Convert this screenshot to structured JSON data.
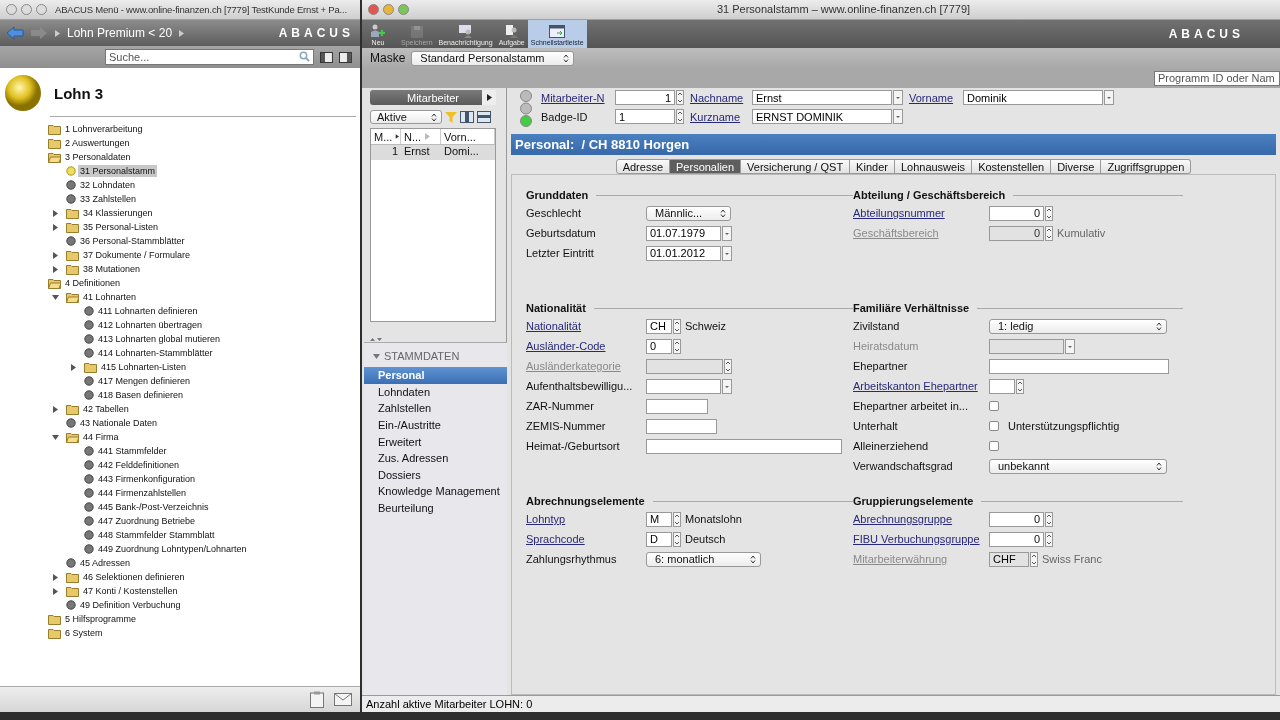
{
  "menu_window": {
    "title": "ABACUS Menü - www.online-finanzen.ch [7779] TestKunde Ernst + Pa...",
    "breadcrumb": "Lohn Premium < 20",
    "logo": "ABACUS",
    "search": {
      "placeholder": "Suche..."
    },
    "heading": "Lohn 3",
    "tree": [
      {
        "label": "1 Lohnverarbeitung",
        "kind": "folder",
        "expanded": false,
        "selected": false
      },
      {
        "label": "2 Auswertungen",
        "kind": "folder",
        "expanded": false,
        "selected": false
      },
      {
        "label": "3 Personaldaten",
        "kind": "folder",
        "expanded": true,
        "selected": false,
        "children": [
          {
            "label": "31 Personalstamm",
            "kind": "program",
            "selected": true
          },
          {
            "label": "32 Lohndaten",
            "kind": "program",
            "selected": false
          },
          {
            "label": "33 Zahlstellen",
            "kind": "program",
            "selected": false
          },
          {
            "label": "34 Klassierungen",
            "kind": "folder",
            "expanded": false,
            "selected": false
          },
          {
            "label": "35 Personal-Listen",
            "kind": "folder",
            "expanded": false,
            "selected": false
          },
          {
            "label": "36 Personal-Stammblätter",
            "kind": "program",
            "selected": false
          },
          {
            "label": "37 Dokumente / Formulare",
            "kind": "folder",
            "expanded": false,
            "selected": false
          },
          {
            "label": "38 Mutationen",
            "kind": "folder",
            "expanded": false,
            "selected": false
          }
        ]
      },
      {
        "label": "4 Definitionen",
        "kind": "folder",
        "expanded": true,
        "selected": false,
        "children": [
          {
            "label": "41 Lohnarten",
            "kind": "folder",
            "expanded": true,
            "selected": false,
            "children": [
              {
                "label": "411 Lohnarten definieren",
                "kind": "program",
                "selected": false
              },
              {
                "label": "412 Lohnarten übertragen",
                "kind": "program",
                "selected": false
              },
              {
                "label": "413 Lohnarten global mutieren",
                "kind": "program",
                "selected": false
              },
              {
                "label": "414 Lohnarten-Stammblätter",
                "kind": "program",
                "selected": false
              },
              {
                "label": "415 Lohnarten-Listen",
                "kind": "folder",
                "expanded": false,
                "selected": false
              },
              {
                "label": "417 Mengen definieren",
                "kind": "program",
                "selected": false
              },
              {
                "label": "418 Basen definieren",
                "kind": "program",
                "selected": false
              }
            ]
          },
          {
            "label": "42 Tabellen",
            "kind": "folder",
            "expanded": false,
            "selected": false
          },
          {
            "label": "43 Nationale Daten",
            "kind": "program",
            "selected": false
          },
          {
            "label": "44 Firma",
            "kind": "folder",
            "expanded": true,
            "selected": false,
            "children": [
              {
                "label": "441 Stammfelder",
                "kind": "program",
                "selected": false
              },
              {
                "label": "442 Felddefinitionen",
                "kind": "program",
                "selected": false
              },
              {
                "label": "443 Firmenkonfiguration",
                "kind": "program",
                "selected": false
              },
              {
                "label": "444 Firmenzahlstellen",
                "kind": "program",
                "selected": false
              },
              {
                "label": "445 Bank-/Post-Verzeichnis",
                "kind": "program",
                "selected": false
              },
              {
                "label": "447 Zuordnung Betriebe",
                "kind": "program",
                "selected": false
              },
              {
                "label": "448 Stammfelder Stammblatt",
                "kind": "program",
                "selected": false
              },
              {
                "label": "449 Zuordnung Lohntypen/Lohnarten",
                "kind": "program",
                "selected": false
              }
            ]
          },
          {
            "label": "45 Adressen",
            "kind": "program",
            "selected": false
          },
          {
            "label": "46 Selektionen definieren",
            "kind": "folder",
            "expanded": false,
            "selected": false
          },
          {
            "label": "47 Konti / Kostenstellen",
            "kind": "folder",
            "expanded": false,
            "selected": false
          },
          {
            "label": "49 Definition Verbuchung",
            "kind": "program",
            "selected": false
          }
        ]
      },
      {
        "label": "5 Hilfsprogramme",
        "kind": "folder",
        "expanded": false,
        "selected": false
      },
      {
        "label": "6 System",
        "kind": "folder",
        "expanded": false,
        "selected": false
      }
    ]
  },
  "program_window": {
    "title": "31 Personalstamm – www.online-finanzen.ch [7779]",
    "logo": "ABACUS",
    "toolbar": [
      {
        "label": "Neu",
        "kind": "new",
        "selected": false,
        "disabled": false
      },
      {
        "label": "Speichern",
        "kind": "save",
        "selected": false,
        "disabled": true
      },
      {
        "label": "Benachrichtigung",
        "kind": "notify",
        "selected": false,
        "disabled": false
      },
      {
        "label": "Aufgabe",
        "kind": "task",
        "selected": false,
        "disabled": false
      },
      {
        "label": "Schnellstartleiste",
        "kind": "quick",
        "selected": true,
        "disabled": false
      }
    ],
    "mask": {
      "label": "Maske",
      "value": "Standard Personalstamm"
    },
    "program_search": {
      "placeholder": "Programm ID oder Nam"
    },
    "employee_list": {
      "title": "Mitarbeiter",
      "filter": "Aktive",
      "columns": [
        "M...",
        "N...",
        "Vorn..."
      ],
      "rows": [
        {
          "cells": [
            "1",
            "Ernst",
            "Domi..."
          ],
          "selected": true
        }
      ]
    },
    "section_list": {
      "title": "STAMMDATEN",
      "items": [
        {
          "label": "Personal",
          "selected": true
        },
        {
          "label": "Lohndaten",
          "selected": false
        },
        {
          "label": "Zahlstellen",
          "selected": false
        },
        {
          "label": "Ein-/Austritte",
          "selected": false
        },
        {
          "label": "Erweitert",
          "selected": false
        },
        {
          "label": "Zus. Adressen",
          "selected": false
        },
        {
          "label": "Dossiers",
          "selected": false
        },
        {
          "label": "Knowledge Management",
          "selected": false
        },
        {
          "label": "Beurteilung",
          "selected": false
        }
      ]
    },
    "header_fields": [
      {
        "label": "Mitarbeiter-N",
        "value": "1",
        "kind": "number"
      },
      {
        "label": "Nachname",
        "value": "Ernst",
        "kind": "text"
      },
      {
        "label": "Vorname",
        "value": "Dominik",
        "kind": "text"
      },
      {
        "label": "Badge-ID",
        "value": "1",
        "kind": "badge"
      },
      {
        "label": "Kurzname",
        "value": "ERNST DOMINIK",
        "kind": "text"
      }
    ],
    "banner": "Personal:  / CH 8810 Horgen",
    "tabs": [
      {
        "label": "Adresse",
        "selected": false
      },
      {
        "label": "Personalien",
        "selected": true
      },
      {
        "label": "Versicherung / QST",
        "selected": false
      },
      {
        "label": "Kinder",
        "selected": false
      },
      {
        "label": "Lohnausweis",
        "selected": false
      },
      {
        "label": "Kostenstellen",
        "selected": false
      },
      {
        "label": "Diverse",
        "selected": false
      },
      {
        "label": "Zugriffsgruppen",
        "selected": false
      }
    ],
    "sections": [
      {
        "title": "Grunddaten",
        "fields": [
          {
            "label": "Geschlecht",
            "link": false,
            "disabled": false,
            "kind": "select",
            "value": "Männlic..."
          },
          {
            "label": "Geburtsdatum",
            "link": false,
            "disabled": false,
            "kind": "date",
            "value": "01.07.1979"
          },
          {
            "label": "Letzter Eintritt",
            "link": false,
            "disabled": false,
            "kind": "date",
            "value": "01.01.2012"
          }
        ]
      },
      {
        "title": "Abteilung / Geschäftsbereich",
        "fields": [
          {
            "label": "Abteilungsnummer",
            "link": true,
            "disabled": false,
            "kind": "number",
            "value": "0"
          },
          {
            "label": "Geschäftsbereich",
            "link": true,
            "disabled": true,
            "kind": "number",
            "value": "0",
            "suffix": "Kumulativ"
          }
        ]
      },
      {
        "title": "Nationalität",
        "fields": [
          {
            "label": "Nationalität",
            "link": true,
            "disabled": false,
            "kind": "code",
            "value": "CH",
            "suffix": "Schweiz"
          },
          {
            "label": "Ausländer-Code",
            "link": true,
            "disabled": false,
            "kind": "code",
            "value": "0"
          },
          {
            "label": "Ausländerkategorie",
            "link": true,
            "disabled": true,
            "kind": "spin-combo"
          },
          {
            "label": "Aufenthaltsbewilligu...",
            "link": false,
            "disabled": false,
            "kind": "date"
          },
          {
            "label": "ZAR-Nummer",
            "link": false,
            "disabled": false,
            "kind": "short-text"
          },
          {
            "label": "ZEMIS-Nummer",
            "link": false,
            "disabled": false,
            "kind": "mid-text"
          },
          {
            "label": "Heimat-/Geburtsort",
            "link": false,
            "disabled": false,
            "kind": "long-text"
          }
        ]
      },
      {
        "title": "Familiäre Verhältnisse",
        "fields": [
          {
            "label": "Zivilstand",
            "link": false,
            "disabled": false,
            "kind": "wide-select",
            "value": "1: ledig"
          },
          {
            "label": "Heiratsdatum",
            "link": false,
            "disabled": true,
            "kind": "date"
          },
          {
            "label": "Ehepartner",
            "link": false,
            "disabled": false,
            "kind": "long-text"
          },
          {
            "label": "Arbeitskanton Ehepartner",
            "link": true,
            "disabled": false,
            "kind": "code"
          },
          {
            "label": "Ehepartner arbeitet in...",
            "link": false,
            "disabled": false,
            "kind": "check",
            "checked": false
          },
          {
            "label": "Unterhalt",
            "link": false,
            "disabled": false,
            "kind": "check",
            "checked": false,
            "suffix": "Unterstützungspflichtig"
          },
          {
            "label": "Alleinerziehend",
            "link": false,
            "disabled": false,
            "kind": "check",
            "checked": false
          },
          {
            "label": "Verwandschaftsgrad",
            "link": false,
            "disabled": false,
            "kind": "wide-select",
            "value": "unbekannt"
          }
        ]
      },
      {
        "title": "Abrechnungselemente",
        "fields": [
          {
            "label": "Lohntyp",
            "link": true,
            "disabled": false,
            "kind": "code",
            "value": "M",
            "suffix": "Monatslohn"
          },
          {
            "label": "Sprachcode",
            "link": true,
            "disabled": false,
            "kind": "code",
            "value": "D",
            "suffix": "Deutsch"
          },
          {
            "label": "Zahlungsrhythmus",
            "link": false,
            "disabled": false,
            "kind": "mid-select",
            "value": "6: monatlich"
          }
        ]
      },
      {
        "title": "Gruppierungselemente",
        "fields": [
          {
            "label": "Abrechnungsgruppe",
            "link": true,
            "disabled": false,
            "kind": "number",
            "value": "0"
          },
          {
            "label": "FIBU Verbuchungsgruppe",
            "link": true,
            "disabled": false,
            "kind": "number",
            "value": "0"
          },
          {
            "label": "Mitarbeiterwährung",
            "link": true,
            "disabled": true,
            "kind": "currency",
            "value": "CHF",
            "suffix": "Swiss Franc"
          }
        ]
      }
    ],
    "status_bar": "Anzahl aktive Mitarbeiter LOHN: 0"
  }
}
